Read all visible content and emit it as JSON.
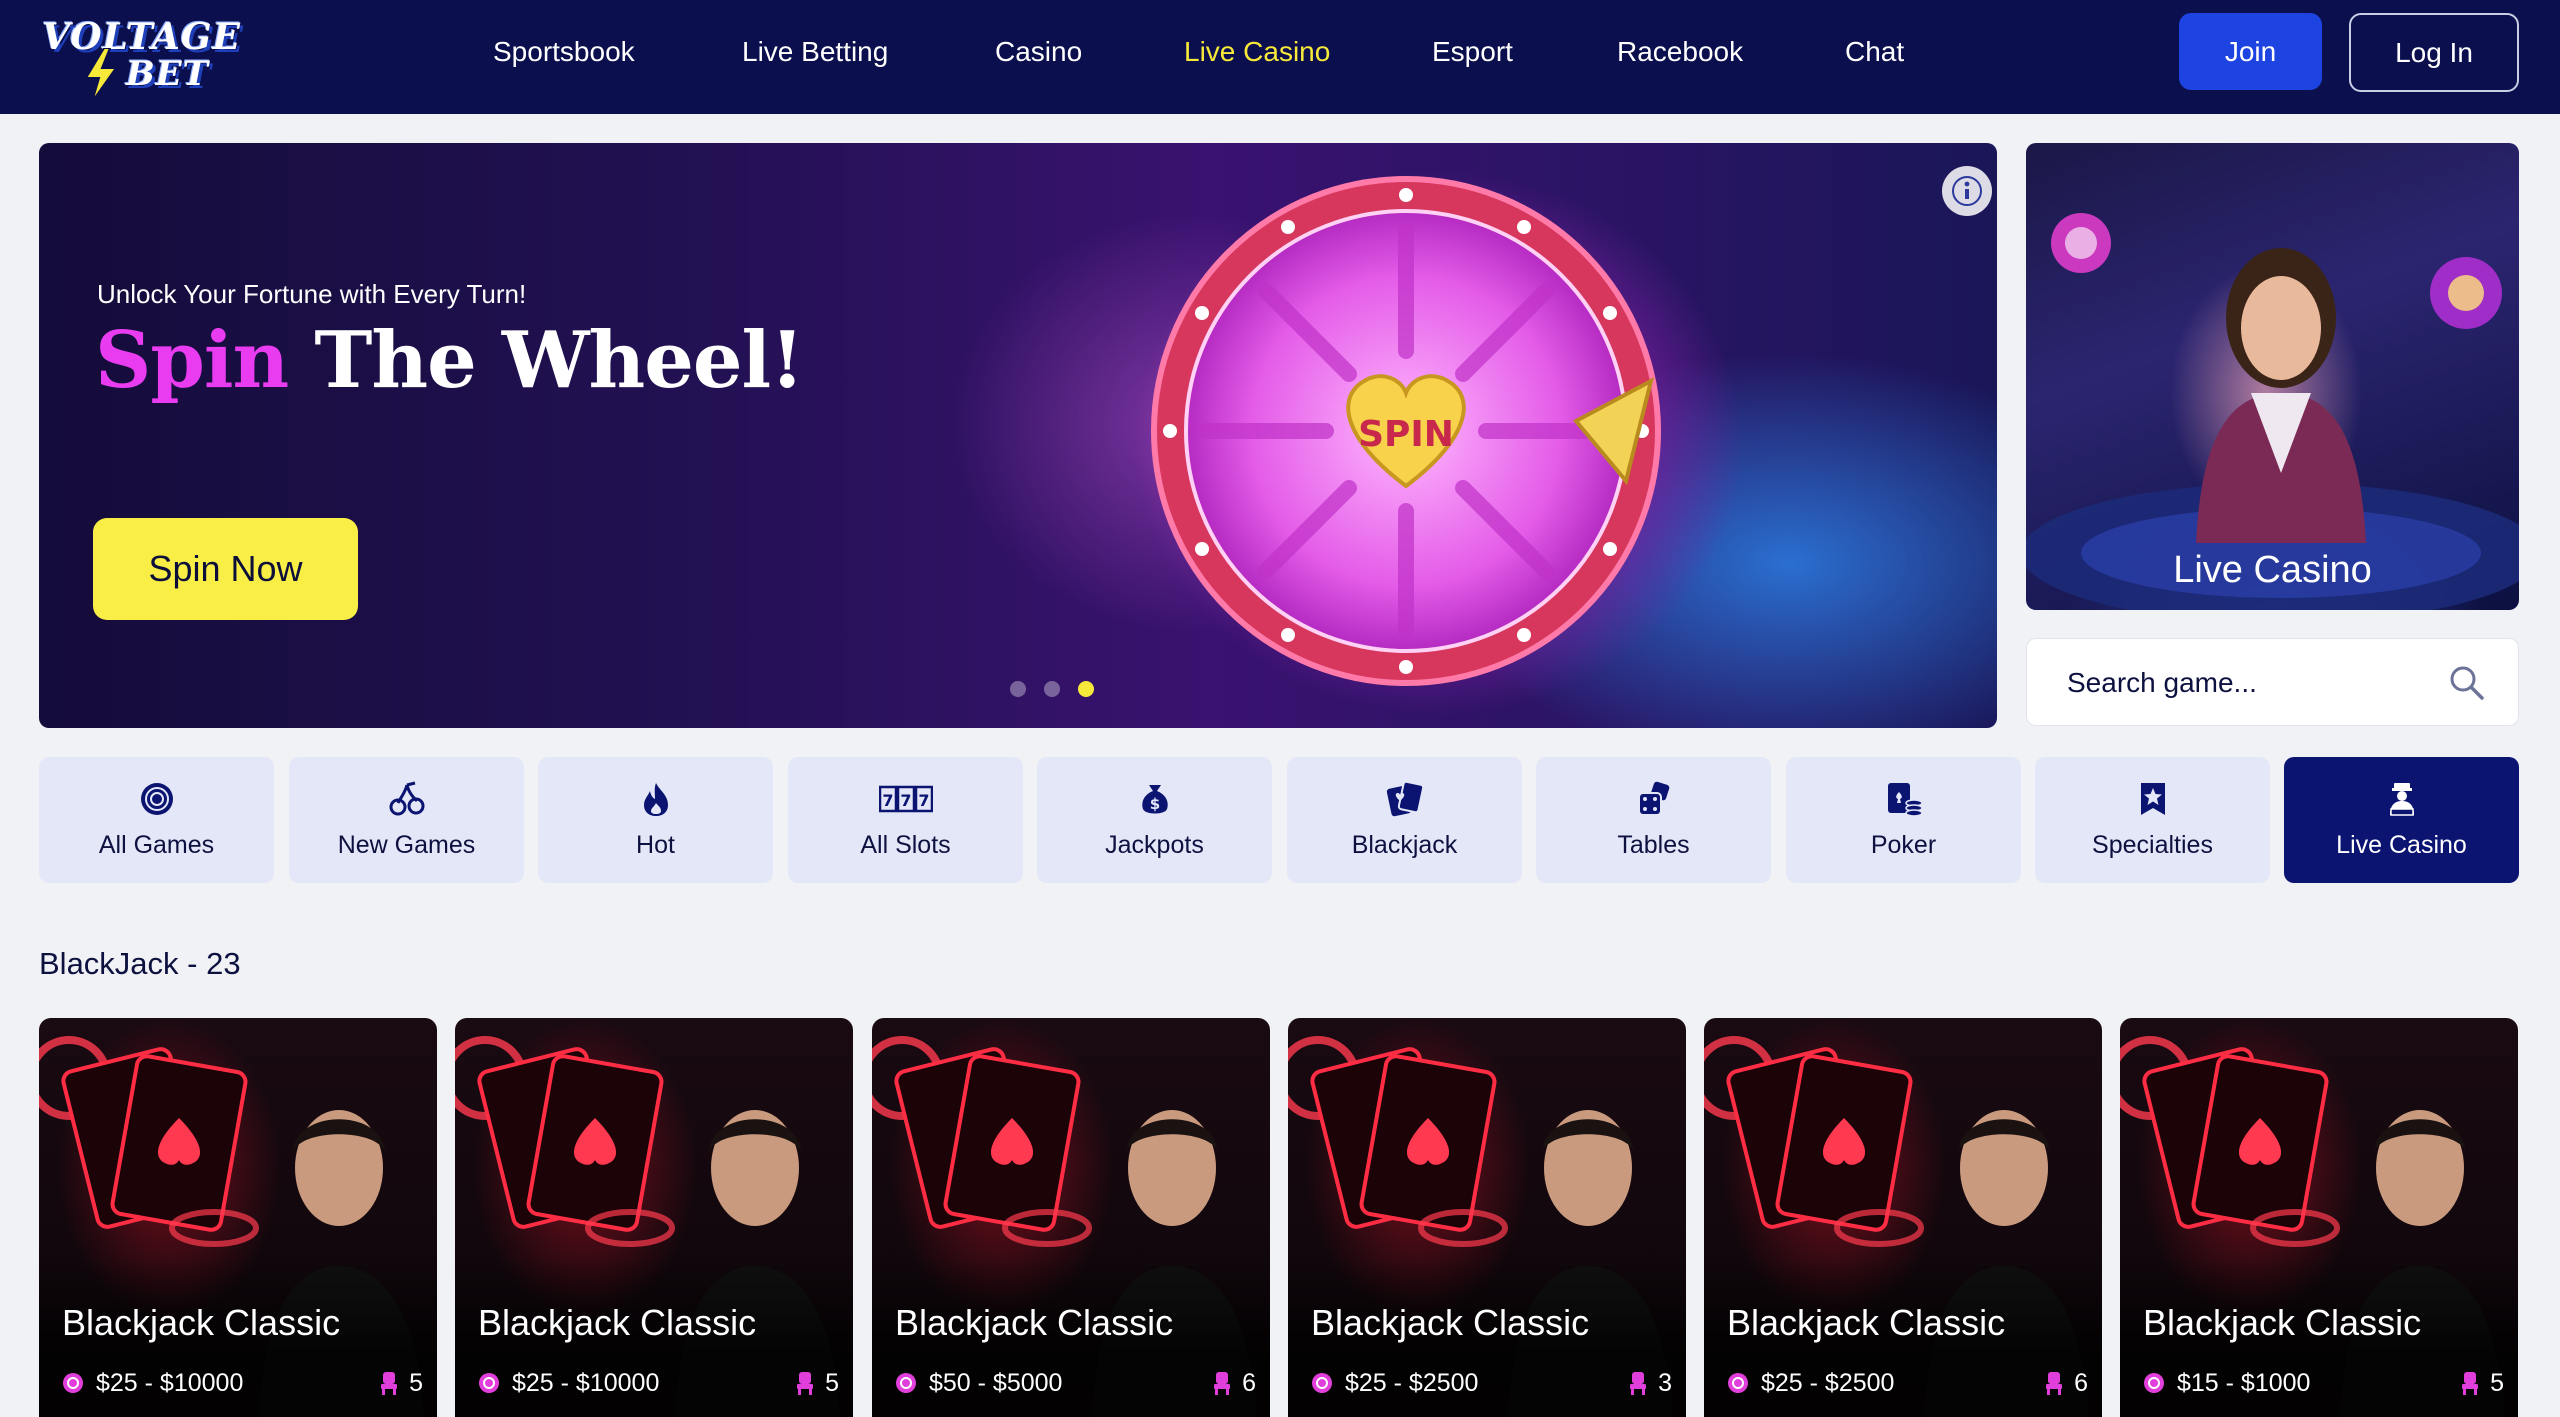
{
  "brand": {
    "logo_line1": "VOLTAGE",
    "logo_line2": "BET"
  },
  "nav": {
    "items": [
      {
        "label": "Sportsbook",
        "active": false
      },
      {
        "label": "Live Betting",
        "active": false
      },
      {
        "label": "Casino",
        "active": false
      },
      {
        "label": "Live Casino",
        "active": true
      },
      {
        "label": "Esport",
        "active": false
      },
      {
        "label": "Racebook",
        "active": false
      },
      {
        "label": "Chat",
        "active": false
      }
    ],
    "join_label": "Join",
    "login_label": "Log In"
  },
  "hero": {
    "tagline": "Unlock Your Fortune with Every Turn!",
    "title_highlight": "Spin",
    "title_rest": "The Wheel!",
    "cta_label": "Spin Now",
    "wheel_center_text": "SPIN",
    "slide_count": 3,
    "active_slide": 3
  },
  "promo": {
    "label": "Live Casino"
  },
  "search": {
    "placeholder": "Search game..."
  },
  "categories": [
    {
      "label": "All Games",
      "icon": "globe-icon",
      "active": false
    },
    {
      "label": "New Games",
      "icon": "cherries-icon",
      "active": false
    },
    {
      "label": "Hot",
      "icon": "flame-icon",
      "active": false
    },
    {
      "label": "All Slots",
      "icon": "slot-777-icon",
      "active": false
    },
    {
      "label": "Jackpots",
      "icon": "money-bag-icon",
      "active": false
    },
    {
      "label": "Blackjack",
      "icon": "cards-icon",
      "active": false
    },
    {
      "label": "Tables",
      "icon": "dice-icon",
      "active": false
    },
    {
      "label": "Poker",
      "icon": "poker-chips-icon",
      "active": false
    },
    {
      "label": "Specialties",
      "icon": "star-badge-icon",
      "active": false
    },
    {
      "label": "Live Casino",
      "icon": "dealer-icon",
      "active": true
    }
  ],
  "section": {
    "title": "BlackJack - 23"
  },
  "games": [
    {
      "title": "Blackjack Classic",
      "range": "$25 - $10000",
      "seats": "5"
    },
    {
      "title": "Blackjack Classic",
      "range": "$25 - $10000",
      "seats": "5"
    },
    {
      "title": "Blackjack Classic",
      "range": "$50 - $5000",
      "seats": "6"
    },
    {
      "title": "Blackjack Classic",
      "range": "$25 - $2500",
      "seats": "3"
    },
    {
      "title": "Blackjack Classic",
      "range": "$25 - $2500",
      "seats": "6"
    },
    {
      "title": "Blackjack Classic",
      "range": "$15 - $1000",
      "seats": "5"
    }
  ],
  "colors": {
    "header_bg": "#0b0f4d",
    "accent_yellow": "#f7e93a",
    "join_blue": "#1d43e0",
    "category_bg": "#e3e7f7",
    "category_active_bg": "#0b1471",
    "highlight_pink": "#e93cf0"
  }
}
